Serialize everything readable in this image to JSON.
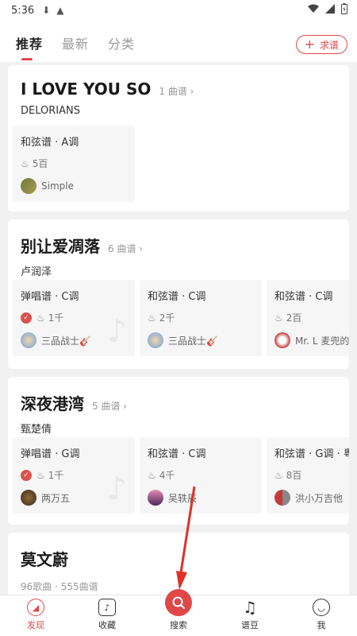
{
  "statusbar": {
    "time": "5:36"
  },
  "topnav": {
    "tabs": [
      "推荐",
      "最新",
      "分类"
    ],
    "request_label": "求谱"
  },
  "cards": [
    {
      "title": "I LOVE YOU SO",
      "count": "1 曲谱",
      "artist": "DELORIANS",
      "tiles": [
        {
          "type": "和弦谱 · A调",
          "hot": "5百",
          "user": "Simple",
          "verified": false
        }
      ]
    },
    {
      "title": "别让爱凋落",
      "count": "6 曲谱",
      "artist": "卢润泽",
      "tiles": [
        {
          "type": "弹唱谱 · C调",
          "hot": "1千",
          "user": "三品战士🎸",
          "verified": true
        },
        {
          "type": "和弦谱 · C调",
          "hot": "2千",
          "user": "三品战士🎸",
          "verified": false
        },
        {
          "type": "和弦谱 · C调",
          "hot": "2百",
          "user": "Mr. L 麦兜的",
          "verified": false
        }
      ]
    },
    {
      "title": "深夜港湾",
      "count": "5 曲谱",
      "artist": "甄楚倩",
      "tiles": [
        {
          "type": "弹唱谱 · G调",
          "hot": "1千",
          "user": "两万五",
          "verified": true
        },
        {
          "type": "和弦谱 · C调",
          "hot": "4千",
          "user": "吴轶辰",
          "verified": false
        },
        {
          "type": "和弦谱 · G调 · 粤",
          "hot": "8百",
          "user": "洪小万吉他",
          "verified": false
        }
      ]
    },
    {
      "title": "莫文蔚",
      "subtitle": "96歌曲 · 555曲谱"
    }
  ],
  "bottomnav": {
    "items": [
      "发现",
      "收藏",
      "搜索",
      "谱豆",
      "我"
    ]
  },
  "colors": {
    "accent": "#e04848"
  }
}
